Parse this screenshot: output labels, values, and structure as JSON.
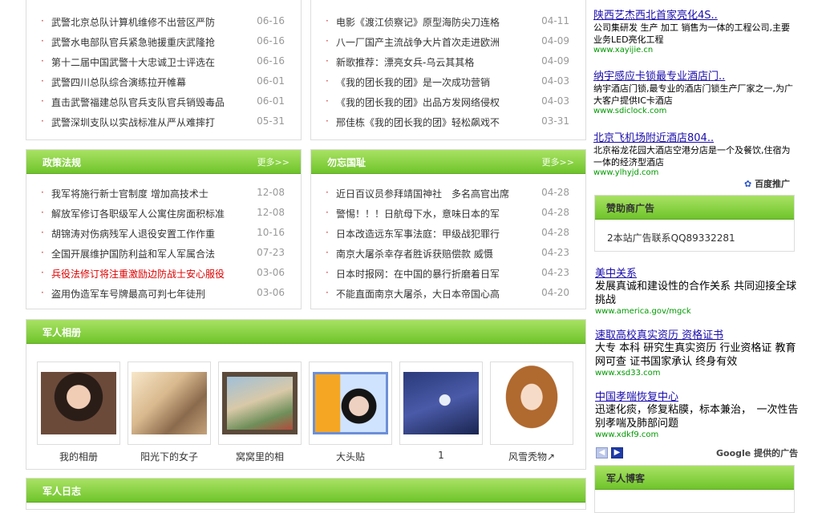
{
  "news_left_top": [
    {
      "title": "武警北京总队计算机维修不出营区严防",
      "date": "06-16"
    },
    {
      "title": "武警水电部队官兵紧急驰援重庆武隆抢",
      "date": "06-16"
    },
    {
      "title": "第十二届中国武警十大忠诚卫士评选在",
      "date": "06-16"
    },
    {
      "title": "武警四川总队综合演练拉开帷幕",
      "date": "06-01"
    },
    {
      "title": "直击武警福建总队官兵支队官兵销毁毒品",
      "date": "06-01"
    },
    {
      "title": "武警深圳支队以实战标准从严从难摔打",
      "date": "05-31"
    }
  ],
  "news_right_top": [
    {
      "title": "电影《渡江侦察记》原型海防尖刀连格",
      "date": "04-11"
    },
    {
      "title": "八一厂国产主流战争大片首次走进欧洲",
      "date": "04-09"
    },
    {
      "title": "新歌推荐：漂亮女兵-乌云其其格",
      "date": "04-09"
    },
    {
      "title": "《我的团长我的团》是一次成功营销",
      "date": "04-03"
    },
    {
      "title": "《我的团长我的团》出品方发网络侵权",
      "date": "04-03"
    },
    {
      "title": "邢佳栋《我的团长我的团》轻松飙戏不",
      "date": "03-31"
    }
  ],
  "policy": {
    "title": "政策法规",
    "more": "更多>>",
    "items": [
      {
        "title": "我军将施行新士官制度 增加高技术士",
        "date": "12-08",
        "red": false
      },
      {
        "title": "解放军修订各职级军人公寓住房面积标准",
        "date": "12-08",
        "red": false
      },
      {
        "title": "胡锦涛对伤病残军人退役安置工作作重",
        "date": "10-16",
        "red": false
      },
      {
        "title": "全国开展维护国防利益和军人军属合法",
        "date": "07-23",
        "red": false
      },
      {
        "title": "兵役法修订将注重激励边防战士安心服役",
        "date": "03-06",
        "red": true
      },
      {
        "title": "盗用伪造军车号牌最高可判七年徒刑",
        "date": "03-06",
        "red": false
      }
    ]
  },
  "shame": {
    "title": "勿忘国耻",
    "more": "更多>>",
    "items": [
      {
        "title": "近日百议员参拜靖国神社　多名高官出席",
        "date": "04-28"
      },
      {
        "title": "警惕！！！日航母下水，意味日本的军",
        "date": "04-28"
      },
      {
        "title": "日本改造远东军事法庭：甲级战犯罪行",
        "date": "04-28"
      },
      {
        "title": "南京大屠杀幸存者胜诉获赔偿款 威慑",
        "date": "04-23"
      },
      {
        "title": "日本时报网：在中国的暴行折磨着日军",
        "date": "04-23"
      },
      {
        "title": "不能直面南京大屠杀，大日本帝国心高",
        "date": "04-20"
      }
    ]
  },
  "album": {
    "title": "军人相册",
    "photos": [
      {
        "caption": "我的相册"
      },
      {
        "caption": "阳光下的女子"
      },
      {
        "caption": "窝窝里的相"
      },
      {
        "caption": "大头贴"
      },
      {
        "caption": "1"
      },
      {
        "caption": "风雪秃物↗"
      }
    ]
  },
  "diary": {
    "title": "军人日志"
  },
  "baidu_ads": [
    {
      "headline": "陕西艺杰西北首家亮化4S..",
      "desc": "公司集研发 生产 加工 销售为一体的工程公司,主要业务LED亮化工程",
      "url": "www.xayijie.cn"
    },
    {
      "headline": "纳宇感应卡锁最专业酒店门..",
      "desc": "纳宇酒店门锁,最专业的酒店门锁生产厂家之一,为广大客户提供IC卡酒店",
      "url": "www.sdiclock.com"
    },
    {
      "headline": "北京飞机场附近酒店804..",
      "desc": "北京裕龙花园大酒店空港分店是一个及餐饮,住宿为一体的经济型酒店",
      "url": "www.ylhyjd.com"
    }
  ],
  "baidu_label": "百度推广",
  "sponsor": {
    "title": "赞助商广告",
    "text": "2本站广告联系QQ89332281"
  },
  "google_ads": [
    {
      "headline": "美中关系",
      "desc": "发展真诚和建设性的合作关系 共同迎接全球挑战",
      "url": "www.america.gov/mgck"
    },
    {
      "headline": "速取高校真实资历 资格证书",
      "desc": "大专 本科 研究生真实资历 行业资格证 教育网可查 证书国家承认 终身有效",
      "url": "www.xsd33.com"
    },
    {
      "headline": "中国孝喘恢复中心",
      "desc": "迅速化痰，修复粘膜，标本兼治，　一次性告别孝喘及肺部问题",
      "url": "www.xdkf9.com"
    }
  ],
  "google_label": "Google 提供的广告",
  "blog": {
    "title": "军人博客"
  },
  "colors": {
    "green_top": "#a9e264",
    "green_bottom": "#6fc42b",
    "link_blue": "#1a0dab",
    "url_green": "#009900"
  }
}
